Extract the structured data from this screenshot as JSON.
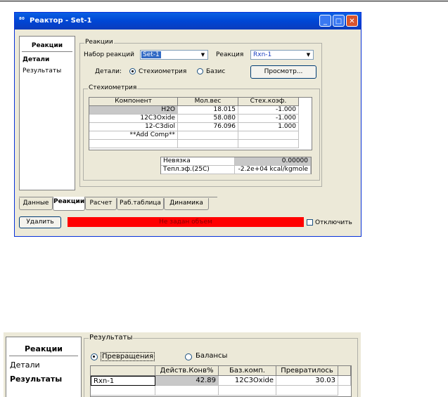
{
  "window": {
    "app_icon": "⁸⁰",
    "title": "Реактор - Set-1",
    "controls": {
      "minimize": "_",
      "maximize": "□",
      "close": "✕"
    }
  },
  "nav": {
    "header": "Реакции",
    "items": [
      "Детали",
      "Результаты"
    ],
    "active_index": 0
  },
  "reactions_group": {
    "label": "Реакции",
    "set_label": "Набор реакций",
    "set_value": "Set-1",
    "reaction_label": "Реакция",
    "reaction_value": "Rxn-1",
    "details_label": "Детали:",
    "radio_stoich": "Стехиометрия",
    "radio_basis": "Базис",
    "view_button": "Просмотр..."
  },
  "stoich_group": {
    "label": "Стехиометрия",
    "columns": [
      "Компонент",
      "Мол.вес",
      "Стех.коэф."
    ],
    "rows": [
      [
        "H2O",
        "18.015",
        "-1.000"
      ],
      [
        "12C3Oxide",
        "58.080",
        "-1.000"
      ],
      [
        "12-C3diol",
        "76.096",
        "1.000"
      ],
      [
        "**Add Comp**",
        "",
        ""
      ]
    ],
    "summary": [
      [
        "Невязка",
        "0.00000"
      ],
      [
        "Тепл.эф.(25C)",
        "-2.2e+04 kcal/kgmole"
      ]
    ]
  },
  "tabs": [
    "Данные",
    "Реакции",
    "Расчет",
    "Раб.таблица",
    "Динамика"
  ],
  "active_tab": "Реакции",
  "footer": {
    "delete_button": "Удалить",
    "status": "Не задан объем",
    "disable_label": "Отключить"
  },
  "panel2": {
    "nav_header": "Реакции",
    "nav_items": [
      "Детали",
      "Результаты"
    ],
    "active_index": 1,
    "group_label": "Результаты",
    "radio_conversions": "Превращения",
    "radio_balances": "Балансы",
    "columns": [
      "",
      "Действ.Конв%",
      "Баз.комп.",
      "Превратилось"
    ],
    "rows": [
      [
        "Rxn-1",
        "42.89",
        "12C3Oxide",
        "30.03"
      ]
    ]
  },
  "colors": {
    "title_blue": "#0046d5",
    "status_red": "#ff0000",
    "close_red": "#d8542d"
  }
}
